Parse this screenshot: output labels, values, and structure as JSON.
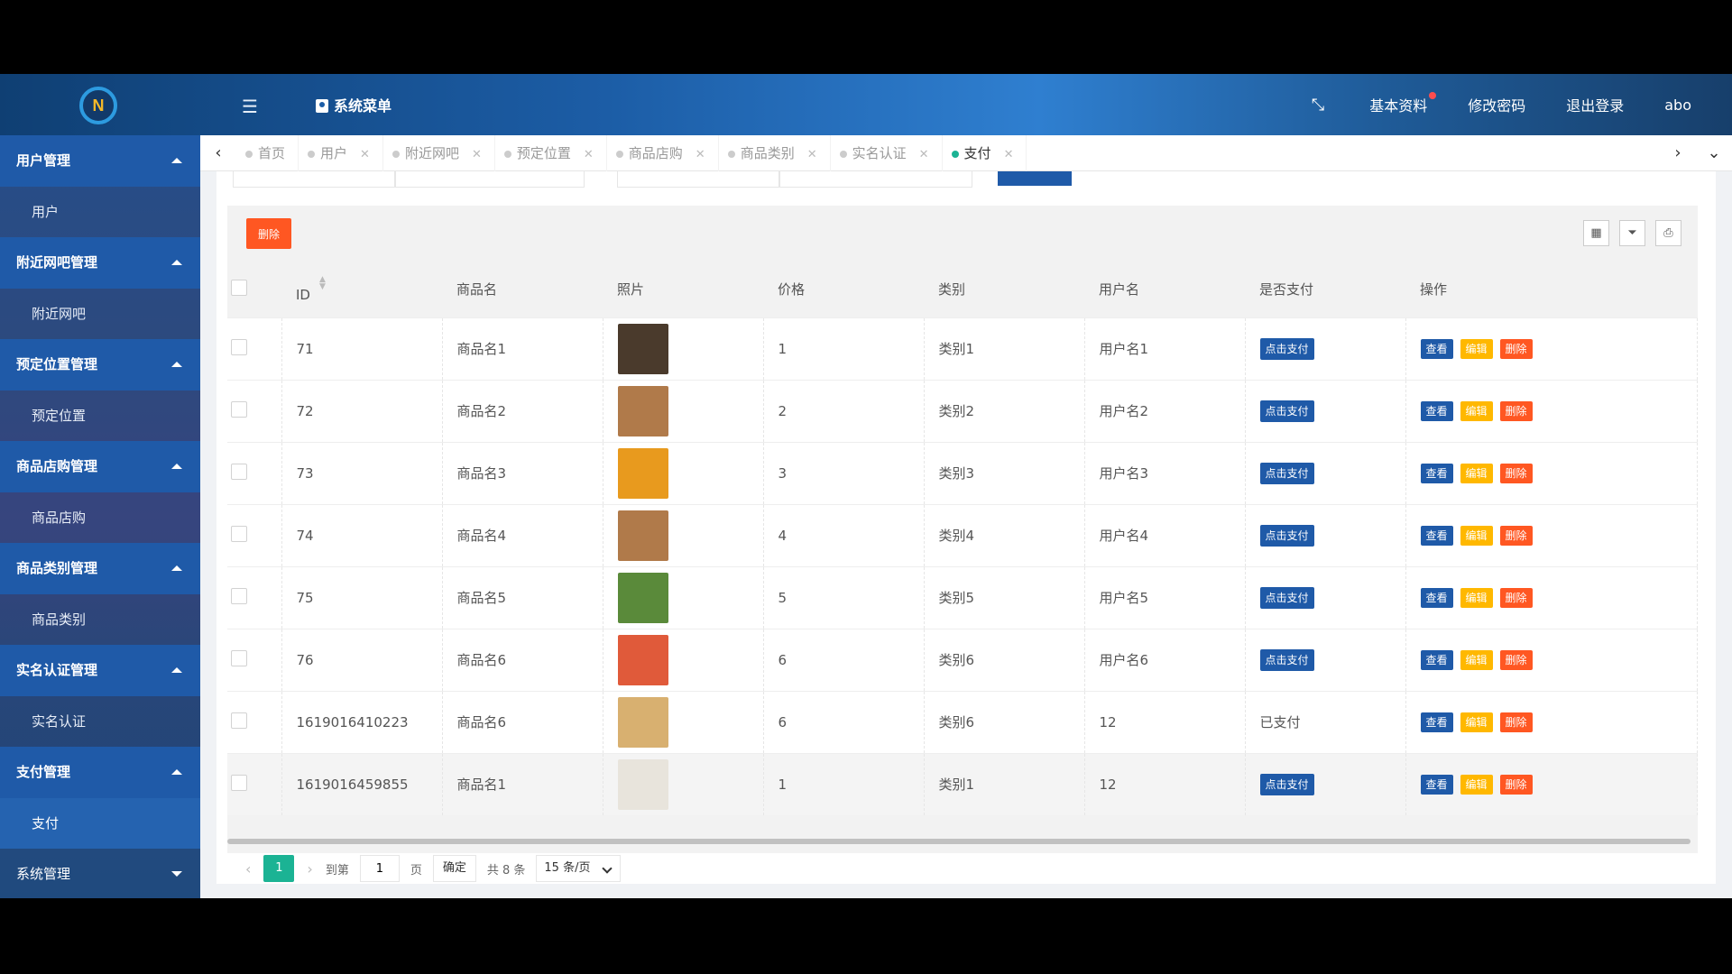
{
  "header": {
    "logo_text": "N",
    "system_menu": "系统菜单",
    "links": [
      "基本资料",
      "修改密码",
      "退出登录"
    ],
    "username": "abo"
  },
  "sidebar": {
    "groups": [
      {
        "label": "用户管理",
        "item": "用户"
      },
      {
        "label": "附近网吧管理",
        "item": "附近网吧"
      },
      {
        "label": "预定位置管理",
        "item": "预定位置"
      },
      {
        "label": "商品店购管理",
        "item": "商品店购"
      },
      {
        "label": "商品类别管理",
        "item": "商品类别"
      },
      {
        "label": "实名认证管理",
        "item": "实名认证"
      },
      {
        "label": "支付管理",
        "item": "支付"
      },
      {
        "label": "系统管理",
        "item": ""
      }
    ]
  },
  "tabs": [
    "首页",
    "用户",
    "附近网吧",
    "预定位置",
    "商品店购",
    "商品类别",
    "实名认证",
    "支付"
  ],
  "toolbar": {
    "delete_label": "删除"
  },
  "table": {
    "columns": [
      "ID",
      "商品名",
      "照片",
      "价格",
      "类别",
      "用户名",
      "是否支付",
      "操作"
    ],
    "rows": [
      {
        "id": "71",
        "name": "商品名1",
        "price": "1",
        "category": "类别1",
        "user": "用户名1",
        "paid": "点击支付",
        "paid_done": false,
        "img": "#4a3a2c"
      },
      {
        "id": "72",
        "name": "商品名2",
        "price": "2",
        "category": "类别2",
        "user": "用户名2",
        "paid": "点击支付",
        "paid_done": false,
        "img": "#b07a4a"
      },
      {
        "id": "73",
        "name": "商品名3",
        "price": "3",
        "category": "类别3",
        "user": "用户名3",
        "paid": "点击支付",
        "paid_done": false,
        "img": "#e89a1e"
      },
      {
        "id": "74",
        "name": "商品名4",
        "price": "4",
        "category": "类别4",
        "user": "用户名4",
        "paid": "点击支付",
        "paid_done": false,
        "img": "#b07a4a"
      },
      {
        "id": "75",
        "name": "商品名5",
        "price": "5",
        "category": "类别5",
        "user": "用户名5",
        "paid": "点击支付",
        "paid_done": false,
        "img": "#5a8a3a"
      },
      {
        "id": "76",
        "name": "商品名6",
        "price": "6",
        "category": "类别6",
        "user": "用户名6",
        "paid": "点击支付",
        "paid_done": false,
        "img": "#e05a3a"
      },
      {
        "id": "1619016410223",
        "name": "商品名6",
        "price": "6",
        "category": "类别6",
        "user": "12",
        "paid": "已支付",
        "paid_done": true,
        "img": "#d8b070"
      },
      {
        "id": "1619016459855",
        "name": "商品名1",
        "price": "1",
        "category": "类别1",
        "user": "12",
        "paid": "点击支付",
        "paid_done": false,
        "img": "#e8e4dc"
      }
    ],
    "actions": {
      "view": "查看",
      "edit": "编辑",
      "delete": "删除"
    }
  },
  "pager": {
    "current": "1",
    "goto_label": "到第",
    "goto_value": "1",
    "page_unit": "页",
    "confirm": "确定",
    "total": "共 8 条",
    "page_size": "15 条/页"
  },
  "colors": {
    "primary": "#1f5aa8",
    "accent": "#1bb394",
    "warning": "#ffb800",
    "danger": "#ff5722"
  }
}
